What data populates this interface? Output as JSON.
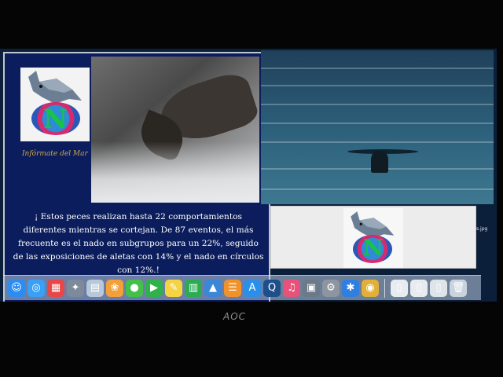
{
  "slide": {
    "slogan": "Infórmate del Mar",
    "logo_letters": "N",
    "caption": "¡ Estos peces realizan hasta 22 comportamientos diferentes mientras se cortejan. De 87 eventos, el más frecuente es el nado en subgrupos para un 22%, seguido de las exposiciones de aletas con 14% y el nado en círculos con 12%.!"
  },
  "panel": {
    "logo_letters": "N",
    "file_label": "s.jpg"
  },
  "dock": {
    "items": [
      {
        "name": "finder-icon",
        "glyph": "☺",
        "color": "#2b8df2"
      },
      {
        "name": "safari-icon",
        "glyph": "◎",
        "color": "#3aa0f5"
      },
      {
        "name": "calendar-icon",
        "glyph": "▦",
        "color": "#e94646"
      },
      {
        "name": "launchpad-icon",
        "glyph": "✦",
        "color": "#7d8a9a"
      },
      {
        "name": "preview-icon",
        "glyph": "▤",
        "color": "#b7c8d8"
      },
      {
        "name": "photos-icon",
        "glyph": "❀",
        "color": "#f2a03a"
      },
      {
        "name": "messages-icon",
        "glyph": "●",
        "color": "#43c04a"
      },
      {
        "name": "facetime-icon",
        "glyph": "▶",
        "color": "#2fb24a"
      },
      {
        "name": "notes-icon",
        "glyph": "✎",
        "color": "#f5d443"
      },
      {
        "name": "numbers-icon",
        "glyph": "▥",
        "color": "#2cab55"
      },
      {
        "name": "keynote-icon",
        "glyph": "▲",
        "color": "#3a86d8"
      },
      {
        "name": "ibooks-icon",
        "glyph": "☰",
        "color": "#f0922c"
      },
      {
        "name": "app-store-icon",
        "glyph": "A",
        "color": "#2a8fe8"
      },
      {
        "name": "quicktime-icon",
        "glyph": "Q",
        "color": "#1d4f8a"
      },
      {
        "name": "itunes-icon",
        "glyph": "♫",
        "color": "#e8527a"
      },
      {
        "name": "sysprefs-small-icon",
        "glyph": "▣",
        "color": "#6b7a88"
      },
      {
        "name": "system-preferences-icon",
        "glyph": "⚙",
        "color": "#8d96a0"
      },
      {
        "name": "bluetooth-icon",
        "glyph": "✱",
        "color": "#2f7fe0"
      },
      {
        "name": "chrome-icon",
        "glyph": "◉",
        "color": "#e0b03a"
      },
      {
        "name": "document-icon",
        "glyph": "▯",
        "color": "#e8ecf0"
      },
      {
        "name": "document-2-icon",
        "glyph": "▯",
        "color": "#e8ecf0"
      },
      {
        "name": "downloads-icon",
        "glyph": "▯",
        "color": "#dfe4ea"
      },
      {
        "name": "trash-icon",
        "glyph": "🗑",
        "color": "#c9d3dd"
      }
    ]
  },
  "monitor": {
    "brand": "AOC"
  }
}
